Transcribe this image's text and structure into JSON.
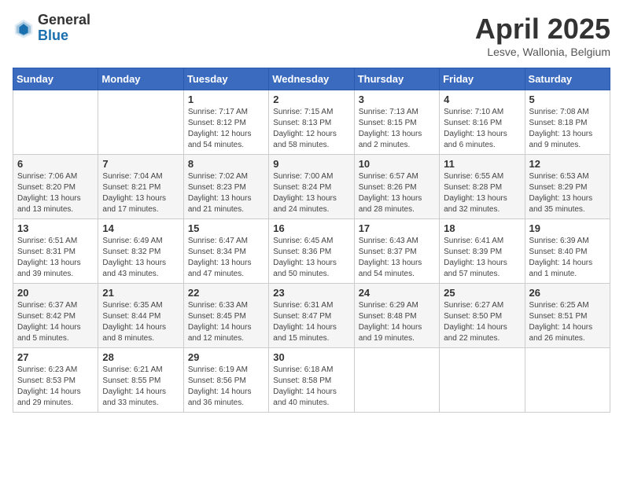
{
  "header": {
    "logo_general": "General",
    "logo_blue": "Blue",
    "month_title": "April 2025",
    "location": "Lesve, Wallonia, Belgium"
  },
  "weekdays": [
    "Sunday",
    "Monday",
    "Tuesday",
    "Wednesday",
    "Thursday",
    "Friday",
    "Saturday"
  ],
  "weeks": [
    [
      {
        "day": "",
        "info": ""
      },
      {
        "day": "",
        "info": ""
      },
      {
        "day": "1",
        "info": "Sunrise: 7:17 AM\nSunset: 8:12 PM\nDaylight: 12 hours and 54 minutes."
      },
      {
        "day": "2",
        "info": "Sunrise: 7:15 AM\nSunset: 8:13 PM\nDaylight: 12 hours and 58 minutes."
      },
      {
        "day": "3",
        "info": "Sunrise: 7:13 AM\nSunset: 8:15 PM\nDaylight: 13 hours and 2 minutes."
      },
      {
        "day": "4",
        "info": "Sunrise: 7:10 AM\nSunset: 8:16 PM\nDaylight: 13 hours and 6 minutes."
      },
      {
        "day": "5",
        "info": "Sunrise: 7:08 AM\nSunset: 8:18 PM\nDaylight: 13 hours and 9 minutes."
      }
    ],
    [
      {
        "day": "6",
        "info": "Sunrise: 7:06 AM\nSunset: 8:20 PM\nDaylight: 13 hours and 13 minutes."
      },
      {
        "day": "7",
        "info": "Sunrise: 7:04 AM\nSunset: 8:21 PM\nDaylight: 13 hours and 17 minutes."
      },
      {
        "day": "8",
        "info": "Sunrise: 7:02 AM\nSunset: 8:23 PM\nDaylight: 13 hours and 21 minutes."
      },
      {
        "day": "9",
        "info": "Sunrise: 7:00 AM\nSunset: 8:24 PM\nDaylight: 13 hours and 24 minutes."
      },
      {
        "day": "10",
        "info": "Sunrise: 6:57 AM\nSunset: 8:26 PM\nDaylight: 13 hours and 28 minutes."
      },
      {
        "day": "11",
        "info": "Sunrise: 6:55 AM\nSunset: 8:28 PM\nDaylight: 13 hours and 32 minutes."
      },
      {
        "day": "12",
        "info": "Sunrise: 6:53 AM\nSunset: 8:29 PM\nDaylight: 13 hours and 35 minutes."
      }
    ],
    [
      {
        "day": "13",
        "info": "Sunrise: 6:51 AM\nSunset: 8:31 PM\nDaylight: 13 hours and 39 minutes."
      },
      {
        "day": "14",
        "info": "Sunrise: 6:49 AM\nSunset: 8:32 PM\nDaylight: 13 hours and 43 minutes."
      },
      {
        "day": "15",
        "info": "Sunrise: 6:47 AM\nSunset: 8:34 PM\nDaylight: 13 hours and 47 minutes."
      },
      {
        "day": "16",
        "info": "Sunrise: 6:45 AM\nSunset: 8:36 PM\nDaylight: 13 hours and 50 minutes."
      },
      {
        "day": "17",
        "info": "Sunrise: 6:43 AM\nSunset: 8:37 PM\nDaylight: 13 hours and 54 minutes."
      },
      {
        "day": "18",
        "info": "Sunrise: 6:41 AM\nSunset: 8:39 PM\nDaylight: 13 hours and 57 minutes."
      },
      {
        "day": "19",
        "info": "Sunrise: 6:39 AM\nSunset: 8:40 PM\nDaylight: 14 hours and 1 minute."
      }
    ],
    [
      {
        "day": "20",
        "info": "Sunrise: 6:37 AM\nSunset: 8:42 PM\nDaylight: 14 hours and 5 minutes."
      },
      {
        "day": "21",
        "info": "Sunrise: 6:35 AM\nSunset: 8:44 PM\nDaylight: 14 hours and 8 minutes."
      },
      {
        "day": "22",
        "info": "Sunrise: 6:33 AM\nSunset: 8:45 PM\nDaylight: 14 hours and 12 minutes."
      },
      {
        "day": "23",
        "info": "Sunrise: 6:31 AM\nSunset: 8:47 PM\nDaylight: 14 hours and 15 minutes."
      },
      {
        "day": "24",
        "info": "Sunrise: 6:29 AM\nSunset: 8:48 PM\nDaylight: 14 hours and 19 minutes."
      },
      {
        "day": "25",
        "info": "Sunrise: 6:27 AM\nSunset: 8:50 PM\nDaylight: 14 hours and 22 minutes."
      },
      {
        "day": "26",
        "info": "Sunrise: 6:25 AM\nSunset: 8:51 PM\nDaylight: 14 hours and 26 minutes."
      }
    ],
    [
      {
        "day": "27",
        "info": "Sunrise: 6:23 AM\nSunset: 8:53 PM\nDaylight: 14 hours and 29 minutes."
      },
      {
        "day": "28",
        "info": "Sunrise: 6:21 AM\nSunset: 8:55 PM\nDaylight: 14 hours and 33 minutes."
      },
      {
        "day": "29",
        "info": "Sunrise: 6:19 AM\nSunset: 8:56 PM\nDaylight: 14 hours and 36 minutes."
      },
      {
        "day": "30",
        "info": "Sunrise: 6:18 AM\nSunset: 8:58 PM\nDaylight: 14 hours and 40 minutes."
      },
      {
        "day": "",
        "info": ""
      },
      {
        "day": "",
        "info": ""
      },
      {
        "day": "",
        "info": ""
      }
    ]
  ]
}
